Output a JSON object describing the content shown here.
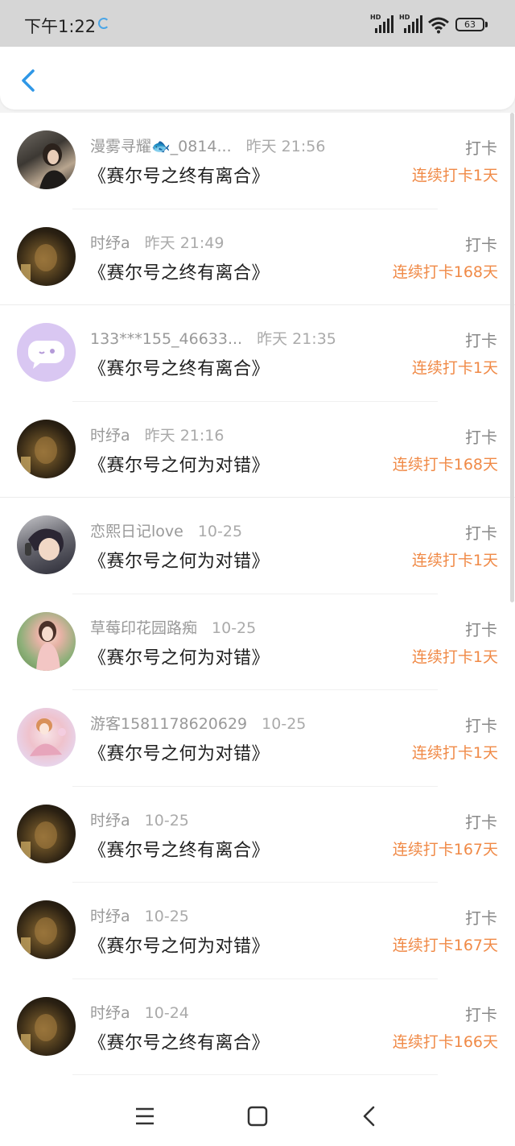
{
  "status_bar": {
    "time": "下午1:22",
    "battery": "63",
    "signal_label": "HD"
  },
  "header": {
    "back_icon": "chevron-left-icon"
  },
  "colors": {
    "accent_orange": "#f08a47",
    "back_blue": "#2f97e6"
  },
  "items": [
    {
      "user": "漫雾寻耀🐟_0814...",
      "time": "昨天 21:56",
      "book": "《赛尔号之终有离合》",
      "tag": "打卡",
      "streak": "连续打卡1天"
    },
    {
      "user": "时纾a",
      "time": "昨天 21:49",
      "book": "《赛尔号之终有离合》",
      "tag": "打卡",
      "streak": "连续打卡168天"
    },
    {
      "user": "133***155_46633...",
      "time": "昨天 21:35",
      "book": "《赛尔号之终有离合》",
      "tag": "打卡",
      "streak": "连续打卡1天"
    },
    {
      "user": "时纾a",
      "time": "昨天 21:16",
      "book": "《赛尔号之何为对错》",
      "tag": "打卡",
      "streak": "连续打卡168天"
    },
    {
      "user": "恋熙日记love",
      "time": "10-25",
      "book": "《赛尔号之何为对错》",
      "tag": "打卡",
      "streak": "连续打卡1天"
    },
    {
      "user": "草莓印花园路痴",
      "time": "10-25",
      "book": "《赛尔号之何为对错》",
      "tag": "打卡",
      "streak": "连续打卡1天"
    },
    {
      "user": "游客1581178620629",
      "time": "10-25",
      "book": "《赛尔号之何为对错》",
      "tag": "打卡",
      "streak": "连续打卡1天"
    },
    {
      "user": "时纾a",
      "time": "10-25",
      "book": "《赛尔号之终有离合》",
      "tag": "打卡",
      "streak": "连续打卡167天"
    },
    {
      "user": "时纾a",
      "time": "10-25",
      "book": "《赛尔号之何为对错》",
      "tag": "打卡",
      "streak": "连续打卡167天"
    },
    {
      "user": "时纾a",
      "time": "10-24",
      "book": "《赛尔号之终有离合》",
      "tag": "打卡",
      "streak": "连续打卡166天"
    }
  ],
  "nav": {
    "menu_icon": "menu-icon",
    "home_icon": "home-square-icon",
    "back_icon": "back-triangle-icon"
  }
}
